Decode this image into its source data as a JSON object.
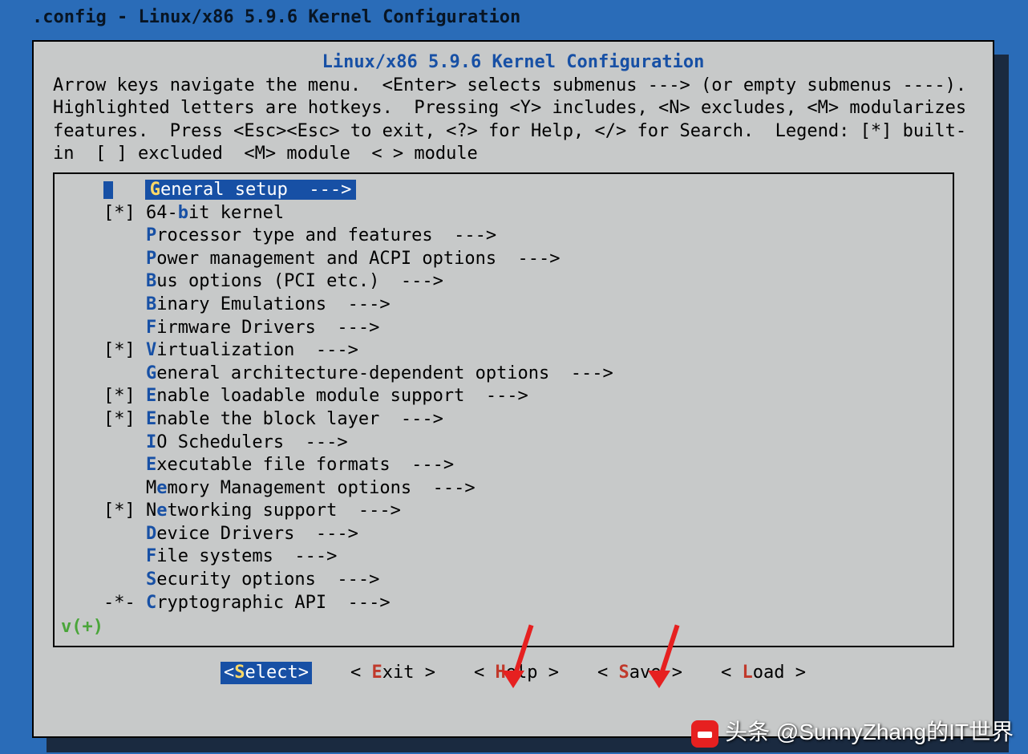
{
  "terminal_header": ".config - Linux/x86 5.9.6 Kernel Configuration",
  "title": "Linux/x86 5.9.6 Kernel Configuration",
  "instructions": "Arrow keys navigate the menu.  <Enter> selects submenus ---> (or empty submenus ----).  Highlighted letters are hotkeys.  Pressing <Y> includes, <N> excludes, <M> modularizes features.  Press <Esc><Esc> to exit, <?> for Help, </> for Search.  Legend: [*] built-in  [ ] excluded  <M> module  < > module",
  "menu": [
    {
      "prefix": "    ",
      "hot": "G",
      "rest": "eneral setup  --->",
      "selected": true
    },
    {
      "prefix": "[*] ",
      "before": "64-",
      "hot": "b",
      "rest": "it kernel"
    },
    {
      "prefix": "    ",
      "hot": "P",
      "rest": "rocessor type and features  --->"
    },
    {
      "prefix": "    ",
      "hot": "P",
      "rest": "ower management and ACPI options  --->"
    },
    {
      "prefix": "    ",
      "hot": "B",
      "rest": "us options (PCI etc.)  --->"
    },
    {
      "prefix": "    ",
      "hot": "B",
      "rest": "inary Emulations  --->"
    },
    {
      "prefix": "    ",
      "hot": "F",
      "rest": "irmware Drivers  --->"
    },
    {
      "prefix": "[*] ",
      "hot": "V",
      "rest": "irtualization  --->"
    },
    {
      "prefix": "    ",
      "hot": "G",
      "rest": "eneral architecture-dependent options  --->"
    },
    {
      "prefix": "[*] ",
      "hot": "E",
      "rest": "nable loadable module support  --->"
    },
    {
      "prefix": "[*] ",
      "hot": "E",
      "rest": "nable the block layer  --->"
    },
    {
      "prefix": "    ",
      "hot": "I",
      "rest": "O Schedulers  --->"
    },
    {
      "prefix": "    ",
      "hot": "E",
      "rest": "xecutable file formats  --->"
    },
    {
      "prefix": "    ",
      "hot": "M",
      "before": "",
      "rest": "",
      "custom": "Memory Management options  --->",
      "hotpos": 1
    },
    {
      "prefix": "[*] ",
      "hot": "N",
      "before": "",
      "rest": "",
      "custom": "Networking support  --->",
      "hotpos": 1
    },
    {
      "prefix": "    ",
      "hot": "D",
      "rest": "evice Drivers  --->"
    },
    {
      "prefix": "    ",
      "hot": "F",
      "rest": "ile systems  --->"
    },
    {
      "prefix": "    ",
      "hot": "S",
      "rest": "ecurity options  --->"
    },
    {
      "prefix": "-*- ",
      "hot": "C",
      "rest": "ryptographic API  --->"
    }
  ],
  "scroll_indicator": "v(+)",
  "buttons": [
    {
      "hot": "S",
      "rest": "elect",
      "selected": true
    },
    {
      "hot": "E",
      "rest": "xit"
    },
    {
      "hot": "H",
      "rest": "elp"
    },
    {
      "hot": "S",
      "rest": "ave"
    },
    {
      "hot": "L",
      "rest": "oad"
    }
  ],
  "credit": "头条 @SunnyZhang的IT世界"
}
